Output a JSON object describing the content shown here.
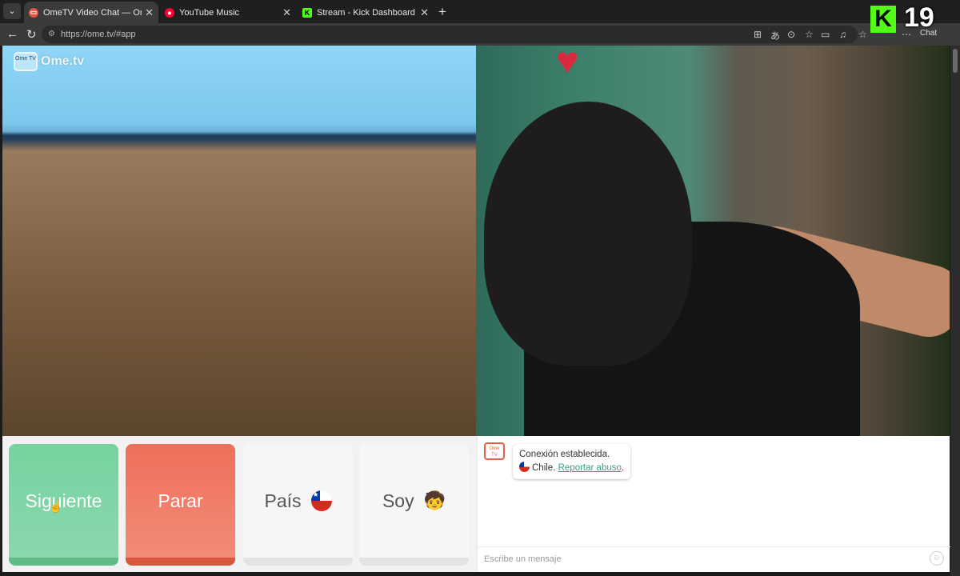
{
  "browser": {
    "tabs": [
      {
        "title": "OmeTV Video Chat — Omegle",
        "active": true,
        "favicon": "ometv-icon"
      },
      {
        "title": "YouTube Music",
        "active": false,
        "favicon": "youtube-music-icon"
      },
      {
        "title": "Stream - Kick Dashboard",
        "active": false,
        "favicon": "kick-icon"
      }
    ],
    "url": "https://ome.tv/#app",
    "chat_label": "Chat"
  },
  "overlay": {
    "kick_letter": "K",
    "viewer_count": "19"
  },
  "app": {
    "logo_text": "Ome.tv",
    "logo_icon_text": "Ome TV",
    "buttons": {
      "next": "Siguiente",
      "stop": "Parar",
      "country": "País",
      "gender": "Soy"
    },
    "chat": {
      "connected": "Conexión establecida.",
      "country": "Chile.",
      "report": "Reportar abuso",
      "report_suffix": ".",
      "input_placeholder": "Escribe un mensaje"
    }
  },
  "colors": {
    "next": "#75d39f",
    "stop": "#ee6f5a",
    "link": "#3aa37a",
    "kick": "#53fc18"
  }
}
